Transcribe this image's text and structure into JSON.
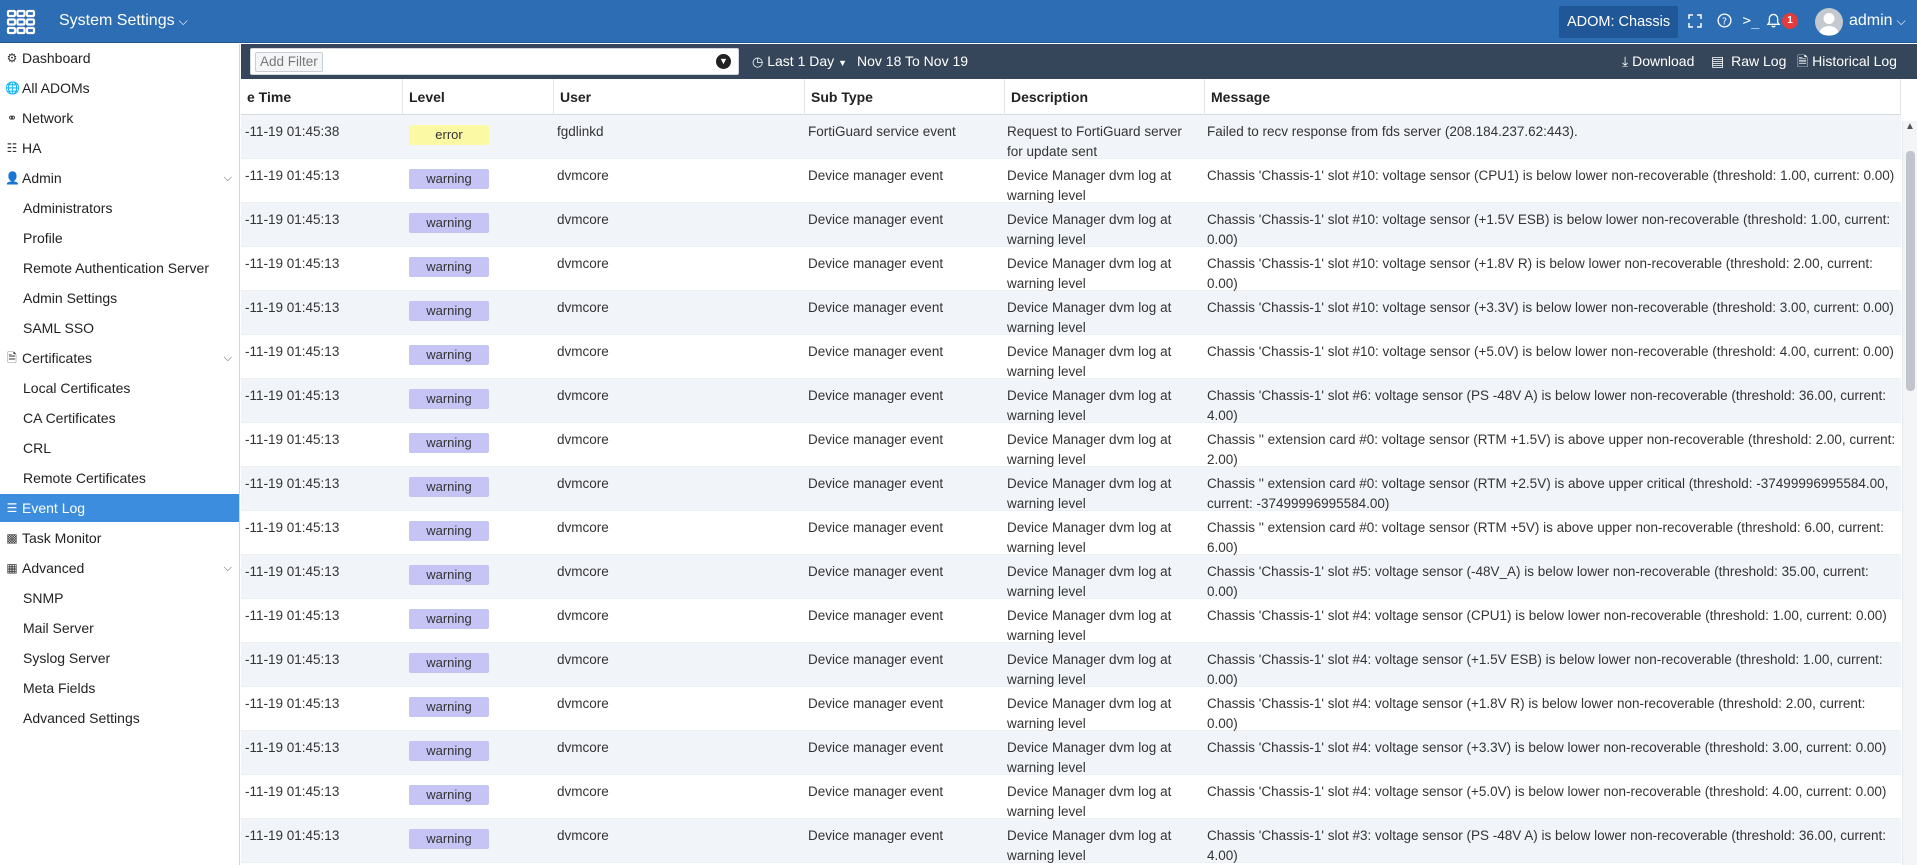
{
  "topbar": {
    "title": "System Settings",
    "adom": "ADOM: Chassis",
    "notification_count": "1",
    "user": "admin"
  },
  "sidebar": {
    "items": [
      {
        "label": "Dashboard",
        "icon": "dashboard-icon"
      },
      {
        "label": "All ADOMs",
        "icon": "globe-icon"
      },
      {
        "label": "Network",
        "icon": "network-icon"
      },
      {
        "label": "HA",
        "icon": "ha-icon"
      },
      {
        "label": "Admin",
        "icon": "user-icon"
      },
      {
        "label": "Administrators"
      },
      {
        "label": "Profile"
      },
      {
        "label": "Remote Authentication Server"
      },
      {
        "label": "Admin Settings"
      },
      {
        "label": "SAML SSO"
      },
      {
        "label": "Certificates",
        "icon": "certificate-icon"
      },
      {
        "label": "Local Certificates"
      },
      {
        "label": "CA Certificates"
      },
      {
        "label": "CRL"
      },
      {
        "label": "Remote Certificates"
      },
      {
        "label": "Event Log",
        "icon": "list-icon"
      },
      {
        "label": "Task Monitor",
        "icon": "monitor-icon"
      },
      {
        "label": "Advanced",
        "icon": "advanced-icon"
      },
      {
        "label": "SNMP"
      },
      {
        "label": "Mail Server"
      },
      {
        "label": "Syslog Server"
      },
      {
        "label": "Meta Fields"
      },
      {
        "label": "Advanced Settings"
      }
    ]
  },
  "toolbar": {
    "filter_placeholder": "Add Filter",
    "time_range": "Last 1 Day",
    "date_range": "Nov 18 To Nov 19",
    "download": "Download",
    "raw_log": "Raw Log",
    "historical_log": "Historical Log"
  },
  "table": {
    "columns": [
      "e Time",
      "Level",
      "User",
      "Sub Type",
      "Description",
      "Message"
    ],
    "rows": [
      {
        "time": "-11-19 01:45:38",
        "level": "error",
        "user": "fgdlinkd",
        "subtype": "FortiGuard service event",
        "description": "Request to FortiGuard server for update sent",
        "message": "Failed to recv response from fds server (208.184.237.62:443)."
      },
      {
        "time": "-11-19 01:45:13",
        "level": "warning",
        "user": "dvmcore",
        "subtype": "Device manager event",
        "description": "Device Manager dvm log at warning level",
        "message": "Chassis 'Chassis-1' slot #10: voltage sensor (CPU1) is below lower non-recoverable (threshold: 1.00, current: 0.00)"
      },
      {
        "time": "-11-19 01:45:13",
        "level": "warning",
        "user": "dvmcore",
        "subtype": "Device manager event",
        "description": "Device Manager dvm log at warning level",
        "message": "Chassis 'Chassis-1' slot #10: voltage sensor (+1.5V ESB) is below lower non-recoverable (threshold: 1.00, current: 0.00)"
      },
      {
        "time": "-11-19 01:45:13",
        "level": "warning",
        "user": "dvmcore",
        "subtype": "Device manager event",
        "description": "Device Manager dvm log at warning level",
        "message": "Chassis 'Chassis-1' slot #10: voltage sensor (+1.8V R) is below lower non-recoverable (threshold: 2.00, current: 0.00)"
      },
      {
        "time": "-11-19 01:45:13",
        "level": "warning",
        "user": "dvmcore",
        "subtype": "Device manager event",
        "description": "Device Manager dvm log at warning level",
        "message": "Chassis 'Chassis-1' slot #10: voltage sensor (+3.3V) is below lower non-recoverable (threshold: 3.00, current: 0.00)"
      },
      {
        "time": "-11-19 01:45:13",
        "level": "warning",
        "user": "dvmcore",
        "subtype": "Device manager event",
        "description": "Device Manager dvm log at warning level",
        "message": "Chassis 'Chassis-1' slot #10: voltage sensor (+5.0V) is below lower non-recoverable (threshold: 4.00, current: 0.00)"
      },
      {
        "time": "-11-19 01:45:13",
        "level": "warning",
        "user": "dvmcore",
        "subtype": "Device manager event",
        "description": "Device Manager dvm log at warning level",
        "message": "Chassis 'Chassis-1' slot #6: voltage sensor (PS -48V A) is below lower non-recoverable (threshold: 36.00, current: 4.00)"
      },
      {
        "time": "-11-19 01:45:13",
        "level": "warning",
        "user": "dvmcore",
        "subtype": "Device manager event",
        "description": "Device Manager dvm log at warning level",
        "message": "Chassis '' extension card #0: voltage sensor (RTM +1.5V) is above upper non-recoverable (threshold: 2.00, current: 2.00)"
      },
      {
        "time": "-11-19 01:45:13",
        "level": "warning",
        "user": "dvmcore",
        "subtype": "Device manager event",
        "description": "Device Manager dvm log at warning level",
        "message": "Chassis '' extension card #0: voltage sensor (RTM +2.5V) is above upper critical (threshold: -37499996995584.00, current: -37499996995584.00)"
      },
      {
        "time": "-11-19 01:45:13",
        "level": "warning",
        "user": "dvmcore",
        "subtype": "Device manager event",
        "description": "Device Manager dvm log at warning level",
        "message": "Chassis '' extension card #0: voltage sensor (RTM +5V) is above upper non-recoverable (threshold: 6.00, current: 6.00)"
      },
      {
        "time": "-11-19 01:45:13",
        "level": "warning",
        "user": "dvmcore",
        "subtype": "Device manager event",
        "description": "Device Manager dvm log at warning level",
        "message": "Chassis 'Chassis-1' slot #5: voltage sensor (-48V_A) is below lower non-recoverable (threshold: 35.00, current: 0.00)"
      },
      {
        "time": "-11-19 01:45:13",
        "level": "warning",
        "user": "dvmcore",
        "subtype": "Device manager event",
        "description": "Device Manager dvm log at warning level",
        "message": "Chassis 'Chassis-1' slot #4: voltage sensor (CPU1) is below lower non-recoverable (threshold: 1.00, current: 0.00)"
      },
      {
        "time": "-11-19 01:45:13",
        "level": "warning",
        "user": "dvmcore",
        "subtype": "Device manager event",
        "description": "Device Manager dvm log at warning level",
        "message": "Chassis 'Chassis-1' slot #4: voltage sensor (+1.5V ESB) is below lower non-recoverable (threshold: 1.00, current: 0.00)"
      },
      {
        "time": "-11-19 01:45:13",
        "level": "warning",
        "user": "dvmcore",
        "subtype": "Device manager event",
        "description": "Device Manager dvm log at warning level",
        "message": "Chassis 'Chassis-1' slot #4: voltage sensor (+1.8V R) is below lower non-recoverable (threshold: 2.00, current: 0.00)"
      },
      {
        "time": "-11-19 01:45:13",
        "level": "warning",
        "user": "dvmcore",
        "subtype": "Device manager event",
        "description": "Device Manager dvm log at warning level",
        "message": "Chassis 'Chassis-1' slot #4: voltage sensor (+3.3V) is below lower non-recoverable (threshold: 3.00, current: 0.00)"
      },
      {
        "time": "-11-19 01:45:13",
        "level": "warning",
        "user": "dvmcore",
        "subtype": "Device manager event",
        "description": "Device Manager dvm log at warning level",
        "message": "Chassis 'Chassis-1' slot #4: voltage sensor (+5.0V) is below lower non-recoverable (threshold: 4.00, current: 0.00)"
      },
      {
        "time": "-11-19 01:45:13",
        "level": "warning",
        "user": "dvmcore",
        "subtype": "Device manager event",
        "description": "Device Manager dvm log at warning level",
        "message": "Chassis 'Chassis-1' slot #3: voltage sensor (PS -48V A) is below lower non-recoverable (threshold: 36.00, current: 4.00)"
      }
    ]
  },
  "colors": {
    "topbar": "#2d6db3",
    "toolbar": "#36465a",
    "active_nav": "#3c8dde",
    "warning": "#c6c4f5",
    "error": "#fcf9a4",
    "badge": "#e43b3b"
  }
}
